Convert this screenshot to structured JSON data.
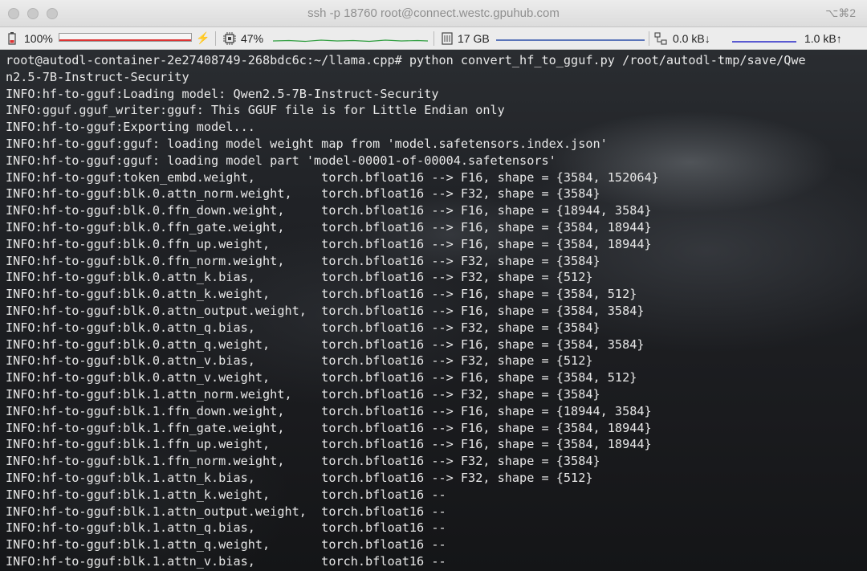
{
  "window": {
    "title": "ssh -p 18760 root@connect.westc.gpuhub.com",
    "shortcut": "⌥⌘2"
  },
  "status": {
    "battery": {
      "label": "100%",
      "level": 1.0,
      "color": "#d33"
    },
    "cpu": {
      "label": "47%",
      "level": 0.47,
      "color": "#2e9e3e"
    },
    "memory": {
      "label": "17 GB",
      "color": "#2a4da8"
    },
    "network": {
      "down": "0.0 kB↓",
      "up": "1.0 kB↑",
      "color": "#2a2ac8"
    }
  },
  "terminal": {
    "lines": [
      "root@autodl-container-2e27408749-268bdc6c:~/llama.cpp# python convert_hf_to_gguf.py /root/autodl-tmp/save/Qwe",
      "n2.5-7B-Instruct-Security",
      "INFO:hf-to-gguf:Loading model: Qwen2.5-7B-Instruct-Security",
      "INFO:gguf.gguf_writer:gguf: This GGUF file is for Little Endian only",
      "INFO:hf-to-gguf:Exporting model...",
      "INFO:hf-to-gguf:gguf: loading model weight map from 'model.safetensors.index.json'",
      "INFO:hf-to-gguf:gguf: loading model part 'model-00001-of-00004.safetensors'",
      "INFO:hf-to-gguf:token_embd.weight,         torch.bfloat16 --> F16, shape = {3584, 152064}",
      "INFO:hf-to-gguf:blk.0.attn_norm.weight,    torch.bfloat16 --> F32, shape = {3584}",
      "INFO:hf-to-gguf:blk.0.ffn_down.weight,     torch.bfloat16 --> F16, shape = {18944, 3584}",
      "INFO:hf-to-gguf:blk.0.ffn_gate.weight,     torch.bfloat16 --> F16, shape = {3584, 18944}",
      "INFO:hf-to-gguf:blk.0.ffn_up.weight,       torch.bfloat16 --> F16, shape = {3584, 18944}",
      "INFO:hf-to-gguf:blk.0.ffn_norm.weight,     torch.bfloat16 --> F32, shape = {3584}",
      "INFO:hf-to-gguf:blk.0.attn_k.bias,         torch.bfloat16 --> F32, shape = {512}",
      "INFO:hf-to-gguf:blk.0.attn_k.weight,       torch.bfloat16 --> F16, shape = {3584, 512}",
      "INFO:hf-to-gguf:blk.0.attn_output.weight,  torch.bfloat16 --> F16, shape = {3584, 3584}",
      "INFO:hf-to-gguf:blk.0.attn_q.bias,         torch.bfloat16 --> F32, shape = {3584}",
      "INFO:hf-to-gguf:blk.0.attn_q.weight,       torch.bfloat16 --> F16, shape = {3584, 3584}",
      "INFO:hf-to-gguf:blk.0.attn_v.bias,         torch.bfloat16 --> F32, shape = {512}",
      "INFO:hf-to-gguf:blk.0.attn_v.weight,       torch.bfloat16 --> F16, shape = {3584, 512}",
      "INFO:hf-to-gguf:blk.1.attn_norm.weight,    torch.bfloat16 --> F32, shape = {3584}",
      "INFO:hf-to-gguf:blk.1.ffn_down.weight,     torch.bfloat16 --> F16, shape = {18944, 3584}",
      "INFO:hf-to-gguf:blk.1.ffn_gate.weight,     torch.bfloat16 --> F16, shape = {3584, 18944}",
      "INFO:hf-to-gguf:blk.1.ffn_up.weight,       torch.bfloat16 --> F16, shape = {3584, 18944}",
      "INFO:hf-to-gguf:blk.1.ffn_norm.weight,     torch.bfloat16 --> F32, shape = {3584}",
      "INFO:hf-to-gguf:blk.1.attn_k.bias,         torch.bfloat16 --> F32, shape = {512}",
      "INFO:hf-to-gguf:blk.1.attn_k.weight,       torch.bfloat16 --",
      "INFO:hf-to-gguf:blk.1.attn_output.weight,  torch.bfloat16 --",
      "INFO:hf-to-gguf:blk.1.attn_q.bias,         torch.bfloat16 --",
      "INFO:hf-to-gguf:blk.1.attn_q.weight,       torch.bfloat16 --",
      "INFO:hf-to-gguf:blk.1.attn_v.bias,         torch.bfloat16 --"
    ]
  }
}
